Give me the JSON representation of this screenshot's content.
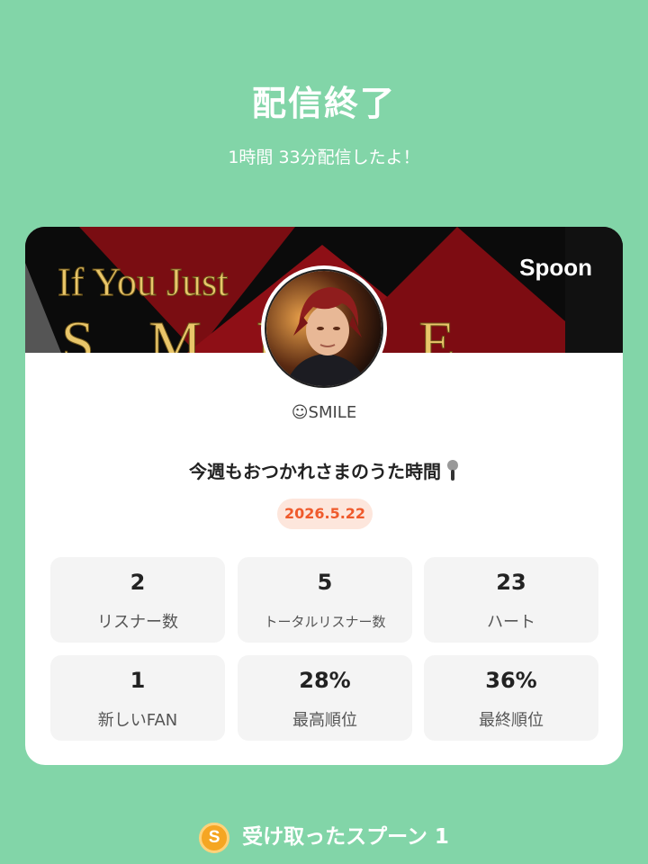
{
  "header": {
    "title": "配信終了",
    "subtitle": "1時間 33分配信したよ！"
  },
  "card": {
    "banner_text_line1": "If You Just",
    "banner_text_line2": "S M I L E",
    "brand": "Spoon",
    "username": "☺SMILE",
    "show_title": "今週もおつかれさまのうた時間",
    "date": "2026.5.22",
    "stats": [
      {
        "value": "2",
        "label": "リスナー数"
      },
      {
        "value": "5",
        "label": "トータルリスナー数"
      },
      {
        "value": "23",
        "label": "ハート"
      },
      {
        "value": "1",
        "label": "新しいFAN"
      },
      {
        "value": "28%",
        "label": "最高順位"
      },
      {
        "value": "36%",
        "label": "最終順位"
      }
    ]
  },
  "footer": {
    "coin_letter": "S",
    "spoons_label": "受け取ったスプーン 1"
  },
  "colors": {
    "background": "#82d5a8",
    "badge_text": "#ef5a2c",
    "badge_bg": "#fde6dc"
  },
  "icons": {
    "mic": "microphone-icon",
    "coin": "spoon-coin-icon"
  }
}
